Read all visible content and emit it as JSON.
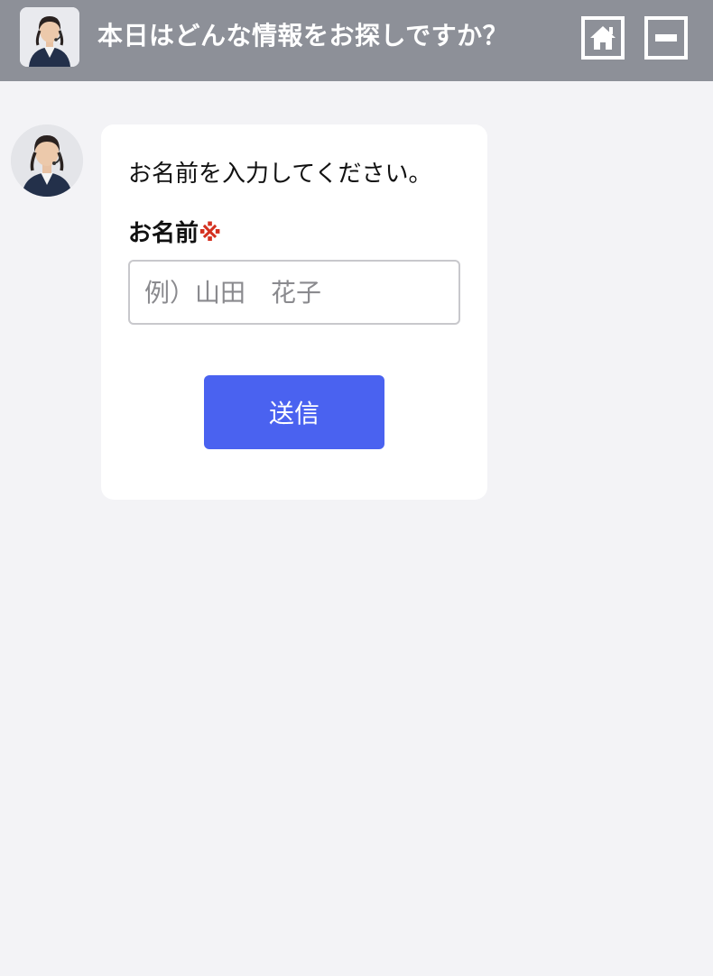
{
  "header": {
    "title": "本日はどんな情報をお探しですか？",
    "avatar_icon": "operator-avatar-icon",
    "home_icon": "home-icon",
    "minimize_icon": "minimize-icon"
  },
  "chat": {
    "prompt": "お名前を入力してください。",
    "field_label": "お名前",
    "required_mark": "※",
    "input_placeholder": "例）山田　花子",
    "input_value": "",
    "submit_label": "送信"
  },
  "colors": {
    "header_bg": "#8d9098",
    "page_bg": "#f3f3f6",
    "accent": "#4a62f0",
    "required": "#d4301f"
  }
}
